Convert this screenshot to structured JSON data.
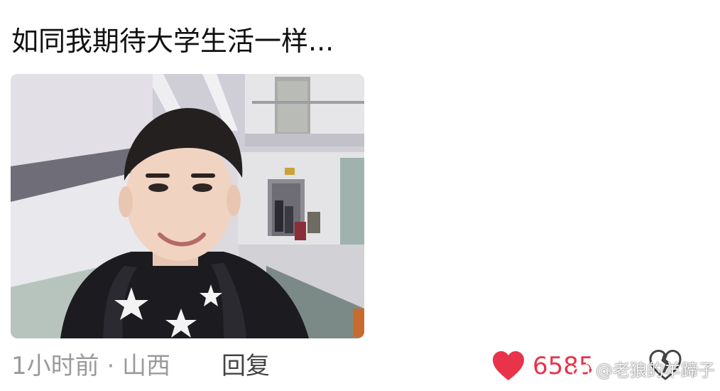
{
  "comment": {
    "text": "如同我期待大学生活一样..."
  },
  "meta": {
    "time_location": "1小时前 · 山西",
    "reply_label": "回复",
    "like_count": "6585",
    "like_color": "#e8334a",
    "like_icon": "heart-icon",
    "dislike_icon": "broken-heart-icon"
  },
  "watermark": {
    "text": "@老狼的羊蹄子",
    "icon": "weibo-logo-icon"
  }
}
